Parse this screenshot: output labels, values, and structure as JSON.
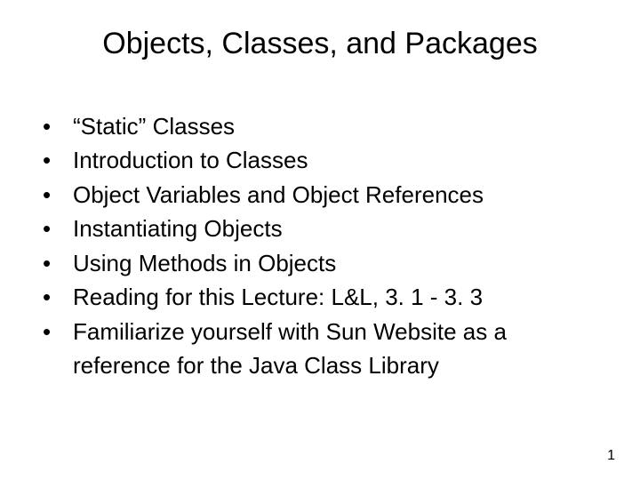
{
  "title": "Objects, Classes, and Packages",
  "bullets": [
    "“Static” Classes",
    "Introduction to Classes",
    "Object Variables and Object References",
    "Instantiating Objects",
    "Using Methods in Objects",
    "Reading for this Lecture: L&L, 3. 1 - 3. 3",
    "Familiarize yourself with Sun Website as a reference for the Java Class Library"
  ],
  "page_number": "1",
  "bullet_glyph": "•"
}
